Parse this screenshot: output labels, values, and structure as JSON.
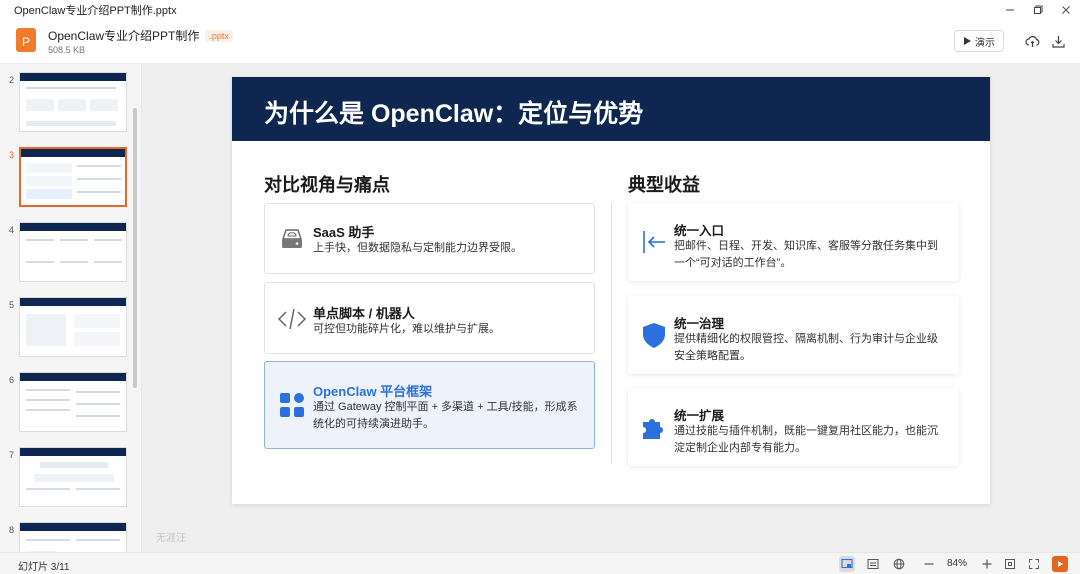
{
  "window": {
    "title": "OpenClaw专业介绍PPT制作.pptx",
    "controls": [
      "minimize",
      "restore",
      "close"
    ]
  },
  "file": {
    "name": "OpenClaw专业介绍PPT制作",
    "ext": ".pptx",
    "size": "508.5 KB",
    "icon_letter": "P"
  },
  "toolbar": {
    "present_label": "演示",
    "icons": [
      "cloud-sync-icon",
      "download-icon"
    ]
  },
  "sidebar": {
    "thumbnails": [
      {
        "num": "2",
        "active": false
      },
      {
        "num": "3",
        "active": true
      },
      {
        "num": "4",
        "active": false
      },
      {
        "num": "5",
        "active": false
      },
      {
        "num": "6",
        "active": false
      },
      {
        "num": "7",
        "active": false
      },
      {
        "num": "8",
        "active": false
      }
    ]
  },
  "canvas": {
    "watermark": "无涯汪"
  },
  "slide": {
    "title": "为什么是 OpenClaw：定位与优势",
    "left_heading": "对比视角与痛点",
    "right_heading": "典型收益",
    "cards": [
      {
        "title": "SaaS 助手",
        "desc": "上手快，但数据隐私与定制能力边界受限。",
        "icon": "server-icon"
      },
      {
        "title": "单点脚本 / 机器人",
        "desc": "可控但功能碎片化，难以维护与扩展。",
        "icon": "code-icon"
      },
      {
        "title": "OpenClaw 平台框架",
        "desc": "通过 Gateway 控制平面 + 多渠道 + 工具/技能，形成系统化的可持续演进助手。",
        "icon": "grid-icon"
      }
    ],
    "benefits": [
      {
        "title": "统一入口",
        "desc": "把邮件、日程、开发、知识库、客服等分散任务集中到一个“可对话的工作台”。",
        "icon": "sign-in-icon"
      },
      {
        "title": "统一治理",
        "desc": "提供精细化的权限管控、隔离机制、行为审计与企业级安全策略配置。",
        "icon": "shield-icon"
      },
      {
        "title": "统一扩展",
        "desc": "通过技能与插件机制，既能一键复用社区能力，也能沉淀定制企业内部专有能力。",
        "icon": "puzzle-icon"
      }
    ],
    "colors": {
      "header": "#0f2650",
      "accent": "#2d6fdc"
    }
  },
  "status": {
    "slide_counter": "幻灯片 3/11",
    "zoom": "84%"
  }
}
